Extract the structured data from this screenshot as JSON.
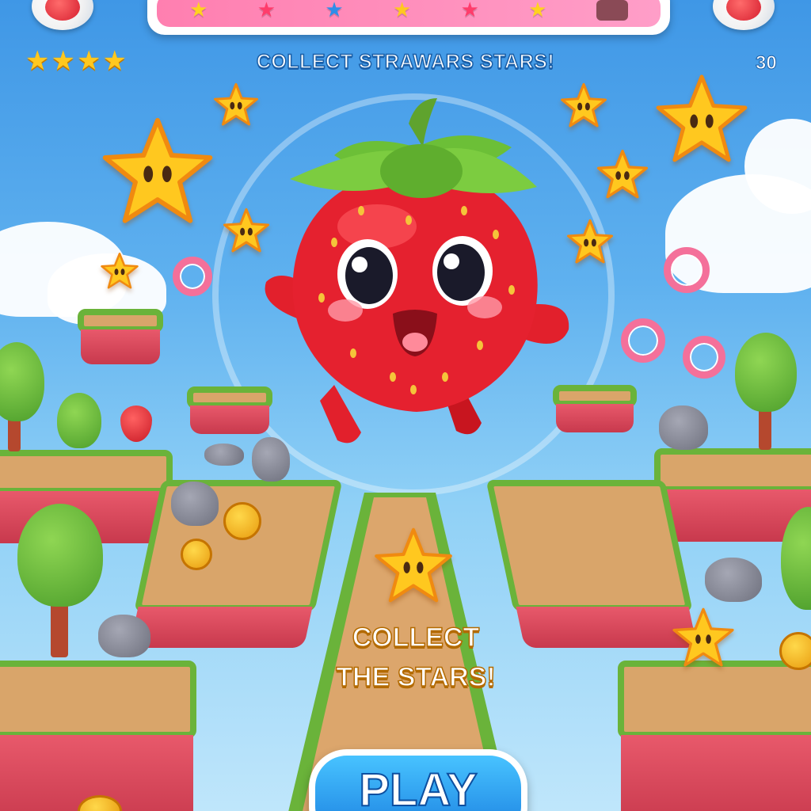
{
  "header": {
    "title": "COLLECT STRAWARS STARS!",
    "timer": "30",
    "rating_stars": [
      "★",
      "★",
      "★",
      "★"
    ],
    "top_bar_items": [
      "★",
      "★",
      "★",
      "★",
      "★",
      "★"
    ]
  },
  "hint": {
    "line1": "COLLECT",
    "line2": "THE STARS!"
  },
  "play_button": {
    "label": "PLAY"
  },
  "colors": {
    "sky": "#4aa3ea",
    "strawberry": "#e5212f",
    "star": "#ffc81f",
    "grass": "#6ab33a",
    "play_button": "#1a7fe0"
  }
}
